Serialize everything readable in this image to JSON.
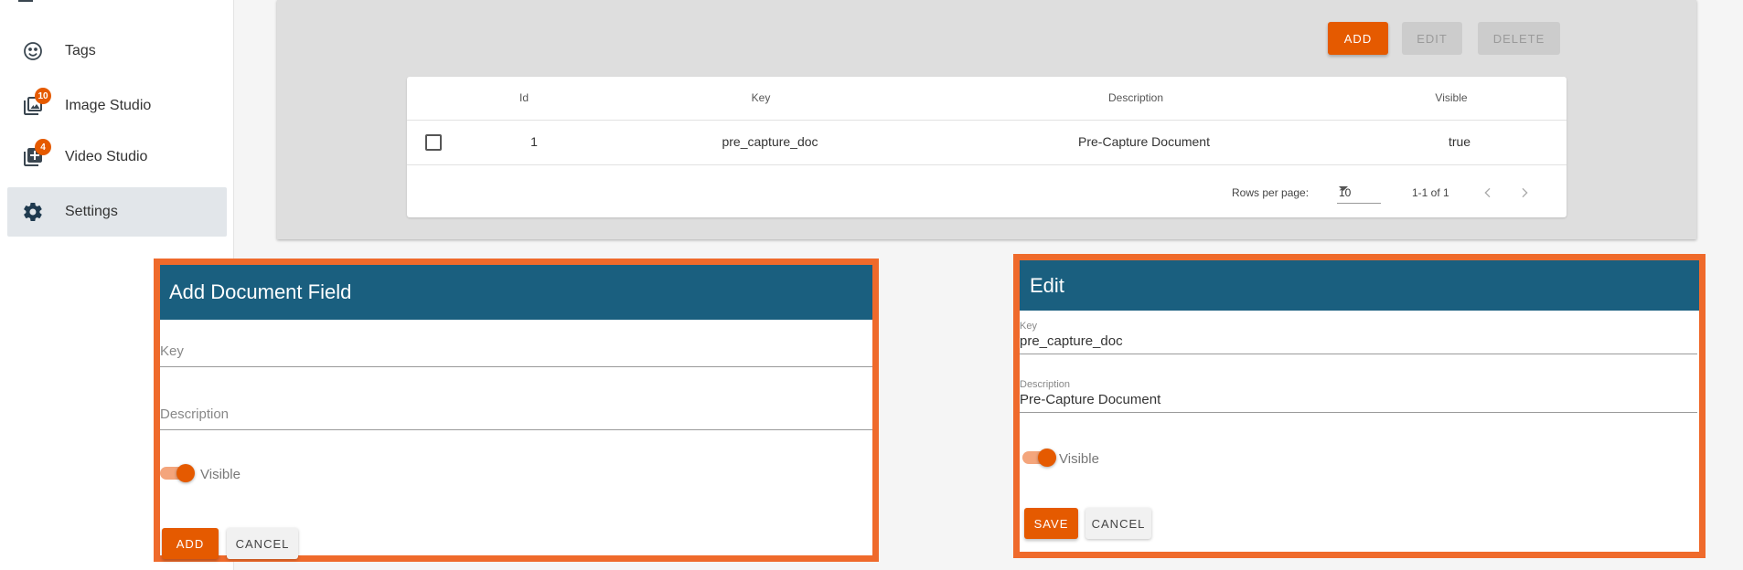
{
  "sidebar": {
    "items": [
      {
        "label": "Tags",
        "icon": "smiley-icon"
      },
      {
        "label": "Image Studio",
        "icon": "image-library-icon",
        "badge": "10"
      },
      {
        "label": "Video Studio",
        "icon": "video-add-icon",
        "badge": "4"
      },
      {
        "label": "Settings",
        "icon": "gear-icon",
        "active": true
      }
    ]
  },
  "toolbar": {
    "add_label": "ADD",
    "edit_label": "EDIT",
    "delete_label": "DELETE"
  },
  "table": {
    "columns": [
      "Id",
      "Key",
      "Description",
      "Visible"
    ],
    "rows": [
      {
        "id": "1",
        "key": "pre_capture_doc",
        "description": "Pre-Capture Document",
        "visible": "true"
      }
    ],
    "pagination": {
      "rows_per_page_label": "Rows per page:",
      "rows_per_page_value": "10",
      "range": "1-1 of 1"
    }
  },
  "add_dialog": {
    "title": "Add Document Field",
    "key_placeholder": "Key",
    "description_placeholder": "Description",
    "visible_label": "Visible",
    "visible_on": true,
    "add_label": "ADD",
    "cancel_label": "CANCEL"
  },
  "edit_dialog": {
    "title": "Edit",
    "key_label": "Key",
    "key_value": "pre_capture_doc",
    "description_label": "Description",
    "description_value": "Pre-Capture Document",
    "visible_label": "Visible",
    "visible_on": true,
    "save_label": "SAVE",
    "cancel_label": "CANCEL"
  },
  "colors": {
    "accent": "#e55a00",
    "header": "#1a5f7f",
    "highlight_border": "#ef6a2b"
  }
}
